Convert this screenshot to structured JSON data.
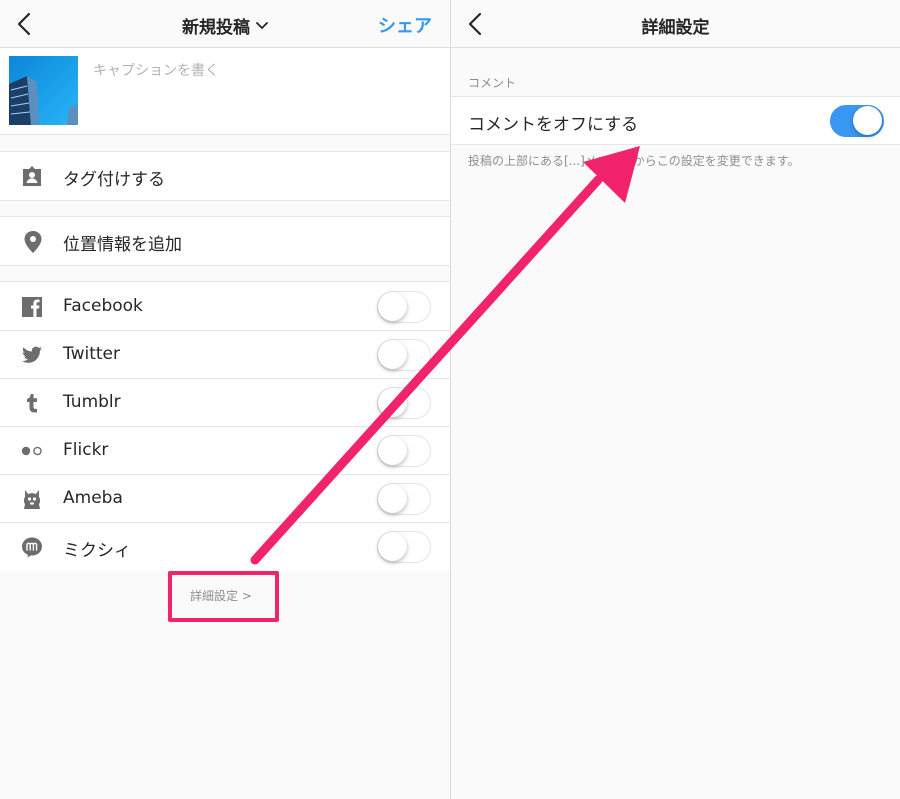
{
  "left_screen": {
    "nav": {
      "title": "新規投稿",
      "share": "シェア"
    },
    "caption_placeholder": "キャプションを書く",
    "rows": {
      "tag": "タグ付けする",
      "location": "位置情報を追加"
    },
    "share_services": [
      {
        "label": "Facebook",
        "icon": "facebook-icon",
        "enabled": false
      },
      {
        "label": "Twitter",
        "icon": "twitter-icon",
        "enabled": false
      },
      {
        "label": "Tumblr",
        "icon": "tumblr-icon",
        "enabled": false
      },
      {
        "label": "Flickr",
        "icon": "flickr-icon",
        "enabled": false
      },
      {
        "label": "Ameba",
        "icon": "ameba-icon",
        "enabled": false
      },
      {
        "label": "ミクシィ",
        "icon": "mixi-icon",
        "enabled": false
      }
    ],
    "advanced_link": "詳細設定 >"
  },
  "right_screen": {
    "nav": {
      "title": "詳細設定"
    },
    "section_header": "コメント",
    "comment_toggle": {
      "label": "コメントをオフにする",
      "enabled": true
    },
    "footnote": "投稿の上部にある[...]メニューからこの設定を変更できます。"
  },
  "colors": {
    "accent": "#3897f0",
    "annotation": "#f0236b",
    "icon_gray": "#6d6d6d",
    "background": "#fafafa"
  }
}
